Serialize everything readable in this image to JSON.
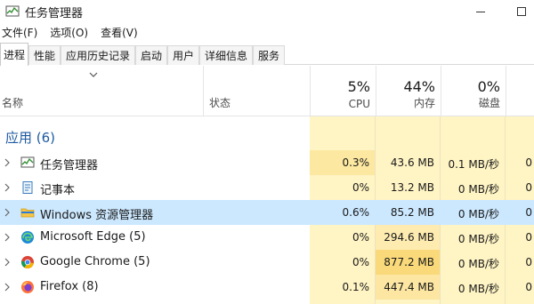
{
  "window": {
    "title": "任务管理器",
    "icon": "task-manager-icon"
  },
  "menu": [
    "文件(F)",
    "选项(O)",
    "查看(V)"
  ],
  "tabs": [
    "进程",
    "性能",
    "应用历史记录",
    "启动",
    "用户",
    "详细信息",
    "服务"
  ],
  "columns": {
    "name": "名称",
    "status": "状态",
    "cpu": {
      "percent": "5%",
      "label": "CPU"
    },
    "memory": {
      "percent": "44%",
      "label": "内存"
    },
    "disk": {
      "percent": "0%",
      "label": "磁盘"
    }
  },
  "group": "应用 (6)",
  "processes": [
    {
      "name": "任务管理器",
      "icon": "task-manager-icon",
      "cpu": "0.3%",
      "memory": "43.6 MB",
      "disk": "0.1 MB/秒",
      "net": "0"
    },
    {
      "name": "记事本",
      "icon": "notepad-icon",
      "cpu": "0%",
      "memory": "13.2 MB",
      "disk": "0 MB/秒",
      "net": "0"
    },
    {
      "name": "Windows 资源管理器",
      "icon": "folder-icon",
      "cpu": "0.6%",
      "memory": "85.2 MB",
      "disk": "0 MB/秒",
      "net": "0"
    },
    {
      "name": "Microsoft Edge (5)",
      "icon": "edge-icon",
      "cpu": "0%",
      "memory": "294.6 MB",
      "disk": "0 MB/秒",
      "net": "0"
    },
    {
      "name": "Google Chrome (5)",
      "icon": "chrome-icon",
      "cpu": "0%",
      "memory": "877.2 MB",
      "disk": "0 MB/秒",
      "net": "0"
    },
    {
      "name": "Firefox (8)",
      "icon": "firefox-icon",
      "cpu": "0.1%",
      "memory": "447.4 MB",
      "disk": "0 MB/秒",
      "net": "0"
    }
  ],
  "colors": {
    "accent": "#1e5aa0",
    "selected_row": "#cce8ff",
    "usage_low": "#fff4c4",
    "usage_high": "#fce8a0"
  }
}
